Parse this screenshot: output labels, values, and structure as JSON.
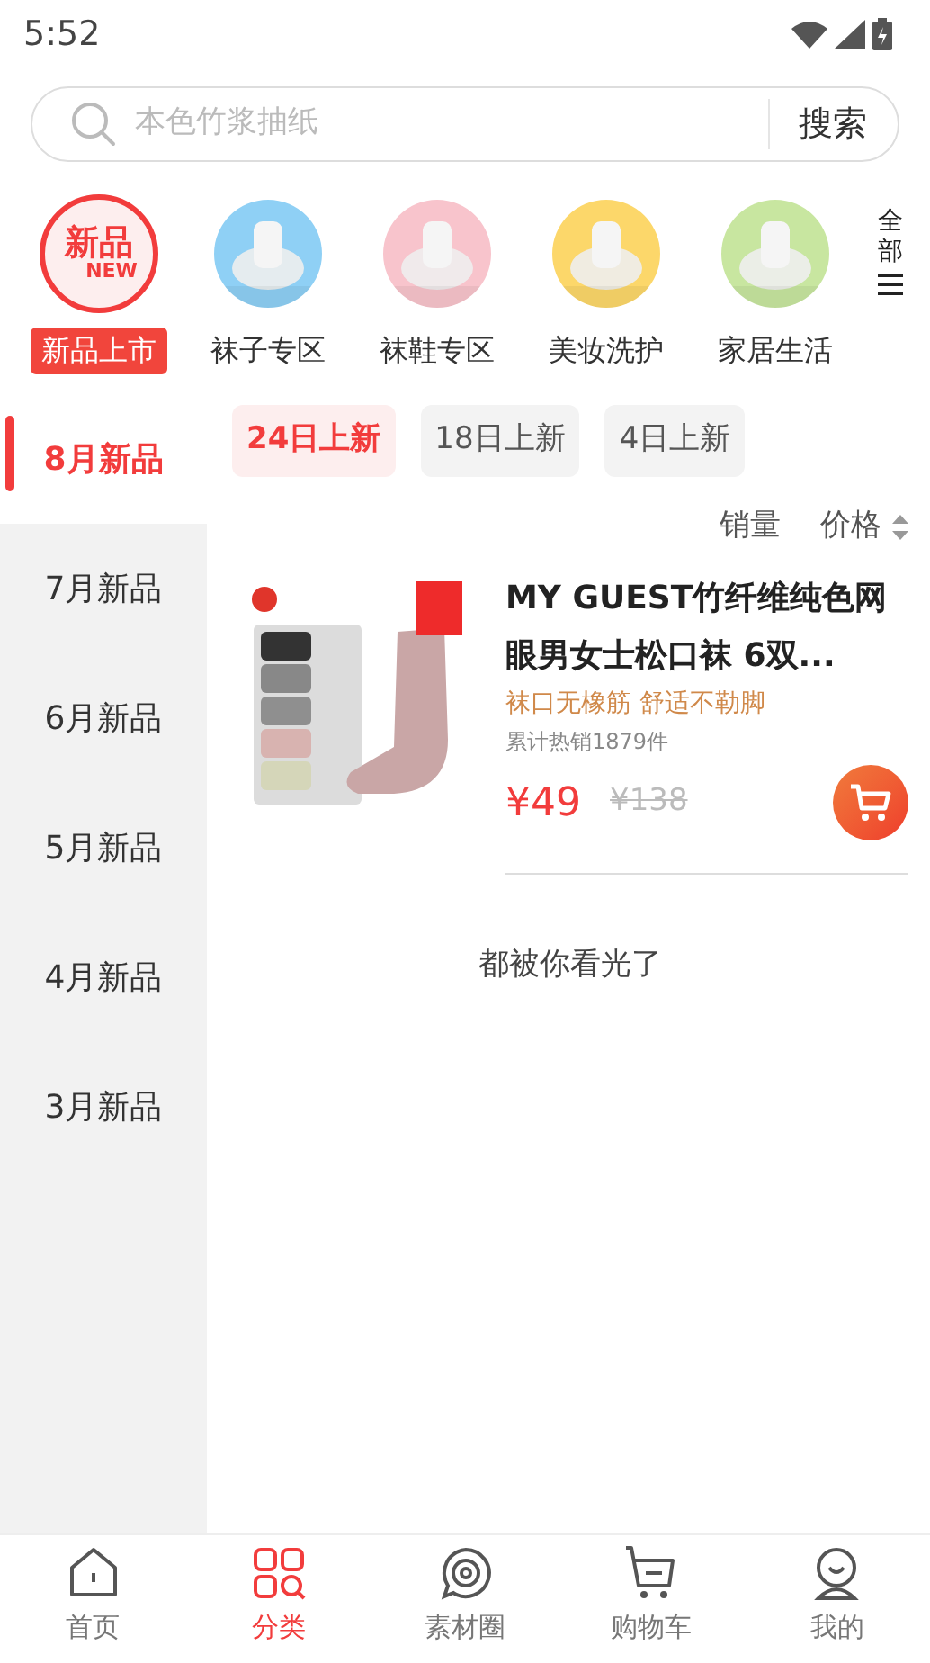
{
  "status_bar": {
    "time": "5:52"
  },
  "search": {
    "placeholder": "本色竹浆抽纸",
    "button": "搜索"
  },
  "categories": [
    {
      "label": "新品上市",
      "selected": true,
      "kind": "logo",
      "logo_text": [
        "新品",
        "NEW"
      ]
    },
    {
      "label": "袜子专区",
      "selected": false,
      "kind": "picture"
    },
    {
      "label": "袜鞋专区",
      "selected": false,
      "kind": "picture"
    },
    {
      "label": "美妆洗护",
      "selected": false,
      "kind": "picture"
    },
    {
      "label": "家居生活",
      "selected": false,
      "kind": "picture"
    }
  ],
  "all_button": "全部",
  "date_tabs": [
    {
      "label": "24日上新",
      "selected": true
    },
    {
      "label": "18日上新",
      "selected": false
    },
    {
      "label": "4日上新",
      "selected": false
    }
  ],
  "months": [
    {
      "label": "8月新品",
      "selected": true
    },
    {
      "label": "7月新品",
      "selected": false
    },
    {
      "label": "6月新品",
      "selected": false
    },
    {
      "label": "5月新品",
      "selected": false
    },
    {
      "label": "4月新品",
      "selected": false
    },
    {
      "label": "3月新品",
      "selected": false
    }
  ],
  "sort": [
    "销量",
    "价格"
  ],
  "products": [
    {
      "title": "MY GUEST竹纤维纯色网眼男女士松口袜 6双...",
      "tagline": "袜口无橡筋 舒适不勒脚",
      "sold": "累计热销1879件",
      "price": "¥49",
      "original_price": "¥138"
    }
  ],
  "end_text": "都被你看光了",
  "tab_bar": [
    {
      "label": "首页",
      "selected": false,
      "kind": "home"
    },
    {
      "label": "分类",
      "selected": true,
      "kind": "grid"
    },
    {
      "label": "素材圈",
      "selected": false,
      "kind": "chat"
    },
    {
      "label": "购物车",
      "selected": false,
      "kind": "cart"
    },
    {
      "label": "我的",
      "selected": false,
      "kind": "user"
    }
  ]
}
